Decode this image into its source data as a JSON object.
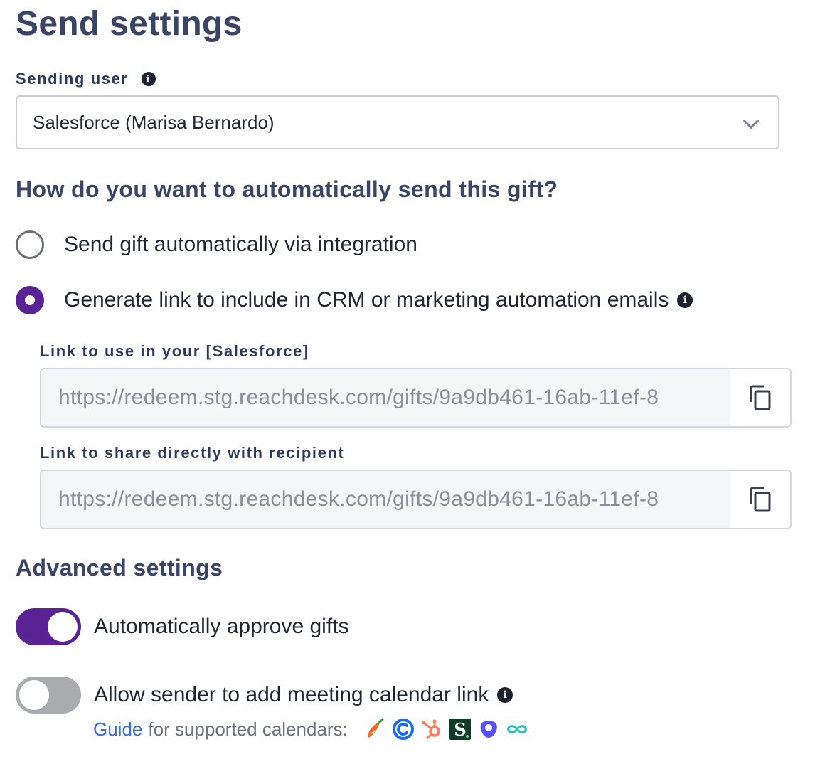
{
  "page": {
    "title": "Send settings"
  },
  "sending_user": {
    "label": "Sending user",
    "selected": "Salesforce (Marisa Bernardo)"
  },
  "question": "How do you want to automatically send this gift?",
  "send_options": [
    {
      "label": "Send gift automatically via integration",
      "selected": false
    },
    {
      "label": "Generate link to include in CRM or marketing automation emails",
      "selected": true
    }
  ],
  "links": {
    "crm_label": "Link to use in your [Salesforce]",
    "crm_value": "https://redeem.stg.reachdesk.com/gifts/9a9db461-16ab-11ef-8",
    "recipient_label": "Link to share directly with recipient",
    "recipient_value": "https://redeem.stg.reachdesk.com/gifts/9a9db461-16ab-11ef-8"
  },
  "advanced": {
    "title": "Advanced settings",
    "auto_approve": {
      "label": "Automatically approve gifts",
      "enabled": true
    },
    "calendar_link": {
      "label": "Allow sender to add meeting calendar link",
      "enabled": false
    },
    "guide_link": "Guide",
    "guide_text": "for supported calendars:",
    "calendar_icons": [
      "chilipiper-icon",
      "calendly-icon",
      "hubspot-icon",
      "salesloft-icon",
      "outreach-icon",
      "infinity-icon"
    ]
  },
  "colors": {
    "heading": "#3a4466",
    "accent": "#5a2295",
    "link": "#3b6fd8",
    "toggle_off": "#a9abaf"
  }
}
